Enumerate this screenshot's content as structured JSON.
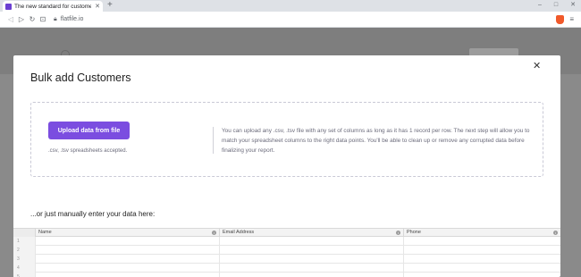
{
  "browser": {
    "tab_title": "The new standard for customer d",
    "tab_close": "✕",
    "new_tab": "+",
    "url": "flatfile.io",
    "controls": [
      "–",
      "□",
      "✕"
    ]
  },
  "modal": {
    "title": "Bulk add Customers",
    "close": "✕",
    "upload_button": "Upload data from file",
    "accepted": ".csv, .tsv spreadsheets accepted.",
    "help_text": "You can upload any .csv, .tsv file with any set of columns as long as it has 1 record per row. The next step will allow you to match your spreadsheet columns to the right data points. You'll be able to clean up or remove any corrupted data before finalizing your report.",
    "manual_label": "...or just manually enter your data here:"
  },
  "grid": {
    "columns": [
      "Name",
      "Email Address",
      "Phone"
    ],
    "rows": [
      "1",
      "2",
      "3",
      "4",
      "5"
    ]
  }
}
